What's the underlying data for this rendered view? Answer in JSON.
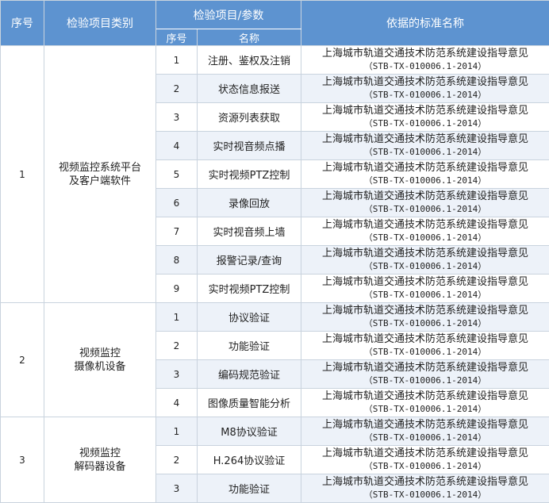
{
  "header": {
    "seq": "序号",
    "category": "检验项目类别",
    "params": "检验项目/参数",
    "sub_seq": "序号",
    "sub_name": "名称",
    "standard": "依据的标准名称"
  },
  "standard": {
    "name": "上海城市轨道交通技术防范系统建设指导意见",
    "code": "（STB-TX-010006.1-2014）"
  },
  "groups": [
    {
      "seq": "1",
      "category_lines": [
        "视频监控系统平台",
        "及客户端软件"
      ],
      "items": [
        {
          "num": "1",
          "name": "注册、鉴权及注销"
        },
        {
          "num": "2",
          "name": "状态信息报送"
        },
        {
          "num": "3",
          "name": "资源列表获取"
        },
        {
          "num": "4",
          "name": "实时视音频点播"
        },
        {
          "num": "5",
          "name": "实时视频PTZ控制"
        },
        {
          "num": "6",
          "name": "录像回放"
        },
        {
          "num": "7",
          "name": "实时视音频上墙"
        },
        {
          "num": "8",
          "name": "报警记录/查询"
        },
        {
          "num": "9",
          "name": "实时视频PTZ控制"
        }
      ]
    },
    {
      "seq": "2",
      "category_lines": [
        "视频监控",
        "摄像机设备"
      ],
      "items": [
        {
          "num": "1",
          "name": "协议验证"
        },
        {
          "num": "2",
          "name": "功能验证"
        },
        {
          "num": "3",
          "name": "编码规范验证"
        },
        {
          "num": "4",
          "name": "图像质量智能分析"
        }
      ]
    },
    {
      "seq": "3",
      "category_lines": [
        "视频监控",
        "解码器设备"
      ],
      "items": [
        {
          "num": "1",
          "name": "M8协议验证"
        },
        {
          "num": "2",
          "name": "H.264协议验证"
        },
        {
          "num": "3",
          "name": "功能验证"
        }
      ]
    }
  ],
  "colors": {
    "header_bg": "#5d93d0",
    "header_text": "#ffffff",
    "row_alt": "#edf2f9",
    "border": "#c9d3de"
  }
}
